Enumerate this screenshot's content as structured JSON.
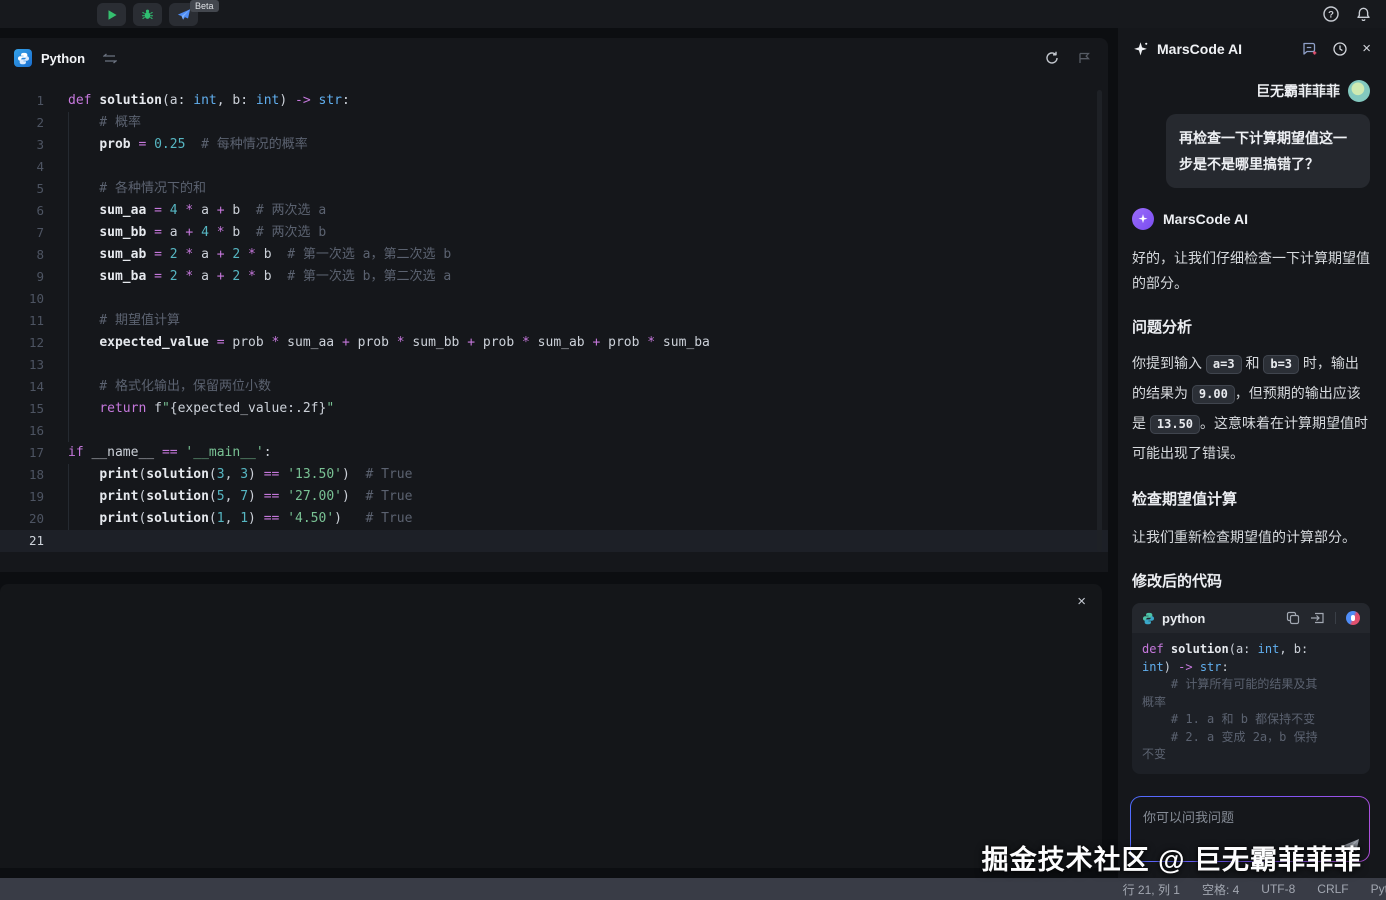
{
  "topbar": {
    "beta": "Beta"
  },
  "tab": {
    "title": "Python"
  },
  "editor": {
    "current_line": 21,
    "lines": [
      [
        [
          "def",
          "k"
        ],
        [
          " ",
          "p"
        ],
        [
          "solution",
          "f"
        ],
        [
          "(a: ",
          "p"
        ],
        [
          "int",
          "t"
        ],
        [
          ", b: ",
          "p"
        ],
        [
          "int",
          "t"
        ],
        [
          ") ",
          "p"
        ],
        [
          "->",
          "k"
        ],
        [
          " ",
          "p"
        ],
        [
          "str",
          "t"
        ],
        [
          ":",
          "p"
        ]
      ],
      [
        [
          "    # 概率",
          "c"
        ]
      ],
      [
        [
          "    ",
          "p"
        ],
        [
          "prob",
          "v"
        ],
        [
          " ",
          "p"
        ],
        [
          "=",
          "k"
        ],
        [
          " ",
          "p"
        ],
        [
          "0.25",
          "n"
        ],
        [
          "  ",
          "p"
        ],
        [
          "# 每种情况的概率",
          "c"
        ]
      ],
      [],
      [
        [
          "    # 各种情况下的和",
          "c"
        ]
      ],
      [
        [
          "    ",
          "p"
        ],
        [
          "sum_aa",
          "v"
        ],
        [
          " ",
          "p"
        ],
        [
          "=",
          "k"
        ],
        [
          " ",
          "p"
        ],
        [
          "4",
          "n"
        ],
        [
          " ",
          "p"
        ],
        [
          "*",
          "k"
        ],
        [
          " a ",
          "p"
        ],
        [
          "+",
          "k"
        ],
        [
          " b  ",
          "p"
        ],
        [
          "# 两次选 a",
          "c"
        ]
      ],
      [
        [
          "    ",
          "p"
        ],
        [
          "sum_bb",
          "v"
        ],
        [
          " ",
          "p"
        ],
        [
          "=",
          "k"
        ],
        [
          " a ",
          "p"
        ],
        [
          "+",
          "k"
        ],
        [
          " ",
          "p"
        ],
        [
          "4",
          "n"
        ],
        [
          " ",
          "p"
        ],
        [
          "*",
          "k"
        ],
        [
          " b  ",
          "p"
        ],
        [
          "# 两次选 b",
          "c"
        ]
      ],
      [
        [
          "    ",
          "p"
        ],
        [
          "sum_ab",
          "v"
        ],
        [
          " ",
          "p"
        ],
        [
          "=",
          "k"
        ],
        [
          " ",
          "p"
        ],
        [
          "2",
          "n"
        ],
        [
          " ",
          "p"
        ],
        [
          "*",
          "k"
        ],
        [
          " a ",
          "p"
        ],
        [
          "+",
          "k"
        ],
        [
          " ",
          "p"
        ],
        [
          "2",
          "n"
        ],
        [
          " ",
          "p"
        ],
        [
          "*",
          "k"
        ],
        [
          " b  ",
          "p"
        ],
        [
          "# 第一次选 a，第二次选 b",
          "c"
        ]
      ],
      [
        [
          "    ",
          "p"
        ],
        [
          "sum_ba",
          "v"
        ],
        [
          " ",
          "p"
        ],
        [
          "=",
          "k"
        ],
        [
          " ",
          "p"
        ],
        [
          "2",
          "n"
        ],
        [
          " ",
          "p"
        ],
        [
          "*",
          "k"
        ],
        [
          " a ",
          "p"
        ],
        [
          "+",
          "k"
        ],
        [
          " ",
          "p"
        ],
        [
          "2",
          "n"
        ],
        [
          " ",
          "p"
        ],
        [
          "*",
          "k"
        ],
        [
          " b  ",
          "p"
        ],
        [
          "# 第一次选 b，第二次选 a",
          "c"
        ]
      ],
      [],
      [
        [
          "    # 期望值计算",
          "c"
        ]
      ],
      [
        [
          "    ",
          "p"
        ],
        [
          "expected_value",
          "v"
        ],
        [
          " ",
          "p"
        ],
        [
          "=",
          "k"
        ],
        [
          " prob ",
          "p"
        ],
        [
          "*",
          "k"
        ],
        [
          " sum_aa ",
          "p"
        ],
        [
          "+",
          "k"
        ],
        [
          " prob ",
          "p"
        ],
        [
          "*",
          "k"
        ],
        [
          " sum_bb ",
          "p"
        ],
        [
          "+",
          "k"
        ],
        [
          " prob ",
          "p"
        ],
        [
          "*",
          "k"
        ],
        [
          " sum_ab ",
          "p"
        ],
        [
          "+",
          "k"
        ],
        [
          " prob ",
          "p"
        ],
        [
          "*",
          "k"
        ],
        [
          " sum_ba",
          "p"
        ]
      ],
      [],
      [
        [
          "    # 格式化输出，保留两位小数",
          "c"
        ]
      ],
      [
        [
          "    ",
          "p"
        ],
        [
          "return",
          "k"
        ],
        [
          " f",
          "p"
        ],
        [
          "\"",
          "s"
        ],
        [
          "{expected_value:.2f}",
          "p"
        ],
        [
          "\"",
          "s"
        ]
      ],
      [],
      [
        [
          "if",
          "k"
        ],
        [
          " __name__ ",
          "p"
        ],
        [
          "==",
          "k"
        ],
        [
          " ",
          "p"
        ],
        [
          "'__main__'",
          "s"
        ],
        [
          ":",
          "p"
        ]
      ],
      [
        [
          "    ",
          "p"
        ],
        [
          "print",
          "f"
        ],
        [
          "(",
          "p"
        ],
        [
          "solution",
          "f"
        ],
        [
          "(",
          "p"
        ],
        [
          "3",
          "n"
        ],
        [
          ", ",
          "p"
        ],
        [
          "3",
          "n"
        ],
        [
          ") ",
          "p"
        ],
        [
          "==",
          "k"
        ],
        [
          " ",
          "p"
        ],
        [
          "'13.50'",
          "s"
        ],
        [
          ")  ",
          "p"
        ],
        [
          "# True",
          "c"
        ]
      ],
      [
        [
          "    ",
          "p"
        ],
        [
          "print",
          "f"
        ],
        [
          "(",
          "p"
        ],
        [
          "solution",
          "f"
        ],
        [
          "(",
          "p"
        ],
        [
          "5",
          "n"
        ],
        [
          ", ",
          "p"
        ],
        [
          "7",
          "n"
        ],
        [
          ") ",
          "p"
        ],
        [
          "==",
          "k"
        ],
        [
          " ",
          "p"
        ],
        [
          "'27.00'",
          "s"
        ],
        [
          ")  ",
          "p"
        ],
        [
          "# True",
          "c"
        ]
      ],
      [
        [
          "    ",
          "p"
        ],
        [
          "print",
          "f"
        ],
        [
          "(",
          "p"
        ],
        [
          "solution",
          "f"
        ],
        [
          "(",
          "p"
        ],
        [
          "1",
          "n"
        ],
        [
          ", ",
          "p"
        ],
        [
          "1",
          "n"
        ],
        [
          ") ",
          "p"
        ],
        [
          "==",
          "k"
        ],
        [
          " ",
          "p"
        ],
        [
          "'4.50'",
          "s"
        ],
        [
          ")   ",
          "p"
        ],
        [
          "# True",
          "c"
        ]
      ],
      []
    ]
  },
  "chat": {
    "panel_title": "MarsCode AI",
    "user": {
      "name": "巨无霸菲菲菲",
      "message": "再检查一下计算期望值这一步是不是哪里搞错了？"
    },
    "ai": {
      "name": "MarsCode AI",
      "p1": "好的，让我们仔细检查一下计算期望值的部分。",
      "h1": "问题分析",
      "p2": [
        {
          "t": "你提到输入 "
        },
        {
          "t": "a=3",
          "code": true
        },
        {
          "t": " 和 "
        },
        {
          "t": "b=3",
          "code": true
        },
        {
          "t": " 时，输出的结果为 "
        },
        {
          "t": "9.00",
          "code": true
        },
        {
          "t": "，但预期的输出应该是 "
        },
        {
          "t": "13.50",
          "code": true
        },
        {
          "t": "。这意味着在计算期望值时可能出现了错误。"
        }
      ],
      "h2": "检查期望值计算",
      "p3": "让我们重新检查期望值的计算部分。",
      "h3": "修改后的代码",
      "code": {
        "lang": "python",
        "lines": [
          [
            [
              "def",
              "k"
            ],
            [
              " ",
              "p"
            ],
            [
              "solution",
              "f"
            ],
            [
              "(a: ",
              "p"
            ],
            [
              "int",
              "t"
            ],
            [
              ", b:",
              "p"
            ]
          ],
          [
            [
              "int",
              "t"
            ],
            [
              ") ",
              "p"
            ],
            [
              "->",
              "k"
            ],
            [
              " ",
              "p"
            ],
            [
              "str",
              "t"
            ],
            [
              ":",
              "p"
            ]
          ],
          [
            [
              "    # 计算所有可能的结果及其",
              "c"
            ]
          ],
          [
            [
              "概率",
              "c"
            ]
          ],
          [
            [
              "    # 1. a 和 b 都保持不变",
              "c"
            ]
          ],
          [
            [
              "    # 2. a 变成 2a，b 保持",
              "c"
            ]
          ],
          [
            [
              "不变",
              "c"
            ]
          ]
        ]
      }
    },
    "input": {
      "placeholder": "你可以问我问题"
    }
  },
  "statusbar": {
    "items": [
      "行 21, 列 1",
      "空格: 4",
      "UTF-8",
      "CRLF",
      "Python"
    ]
  },
  "watermark": "掘金技术社区 @ 巨无霸菲菲菲",
  "colors": {
    "keyword": "#c678dd",
    "type": "#61afef",
    "number": "#56b6c2",
    "string": "#79c294",
    "comment": "#5b6270",
    "accent_blue": "#4f6dff",
    "accent_purple": "#7a4df0",
    "run_green": "#35c06f",
    "panel_bg": "#15171b",
    "statusbar_bg": "#393c46"
  }
}
